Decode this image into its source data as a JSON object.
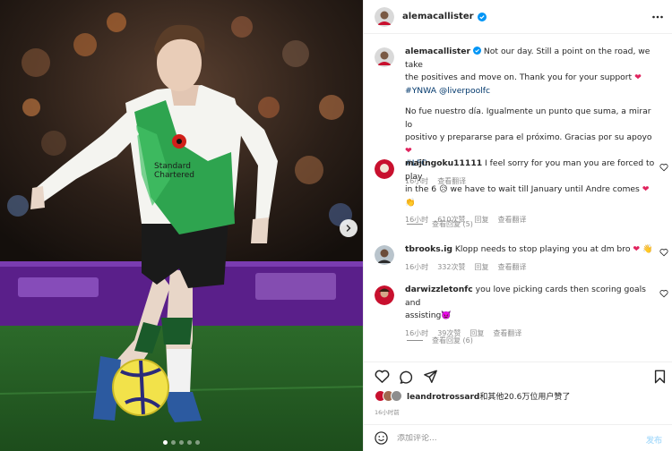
{
  "post": {
    "author": "alemacallister",
    "caption_en_1": "Not our day. Still a point on the road, we take",
    "caption_en_2": "the positives and move on. Thank you for your support ",
    "caption_en_tags": "#YNWA @liverpoolfc",
    "caption_es_1": "No fue nuestro día. Igualmente un punto que suma, a mirar lo",
    "caption_es_2": "positivo y prepararse para el próximo. Gracias por su apoyo ",
    "caption_es_tags": "#LFC",
    "time": "16小时",
    "translate": "查看翻译"
  },
  "comments": [
    {
      "user": "majingoku11111",
      "text_1": "I feel sorry for you man you are forced to play",
      "text_2": "in the 6 ",
      "text_3": " we have to wait till January until Andre comes ",
      "time": "16小时",
      "likes": "610次赞",
      "reply": "回复",
      "translate": "查看翻译",
      "view_replies": "查看回复 (5)"
    },
    {
      "user": "tbrooks.ig",
      "text_1": "Klopp needs to stop playing you at dm bro ",
      "time": "16小时",
      "likes": "332次赞",
      "reply": "回复",
      "translate": "查看翻译"
    },
    {
      "user": "darwizzletonfc",
      "text_1": "you love picking cards then scoring goals and",
      "text_2": "assisting",
      "time": "16小时",
      "likes": "39次赞",
      "reply": "回复",
      "translate": "查看翻译",
      "view_replies": "查看回复 (6)"
    }
  ],
  "likes_line": {
    "user": "leandrotrossard",
    "rest": "和其他20.6万位用户赞了"
  },
  "date": "16小时前",
  "composer": {
    "placeholder": "添加评论...",
    "post_label": "发布"
  },
  "carousel": {
    "slides": 5,
    "active_index": 0
  },
  "icons": {
    "verified": "verified-badge-icon",
    "more": "more-options-icon",
    "like": "heart-icon",
    "comment": "comment-icon",
    "share": "share-icon",
    "save": "bookmark-icon",
    "emoji": "emoji-icon",
    "next": "chevron-right-icon"
  },
  "colors": {
    "verified": "#0095f6",
    "link": "#00376b",
    "meta": "#8e8e8e",
    "heart_red": "#ed4956",
    "kit_green": "#2ea44f"
  }
}
